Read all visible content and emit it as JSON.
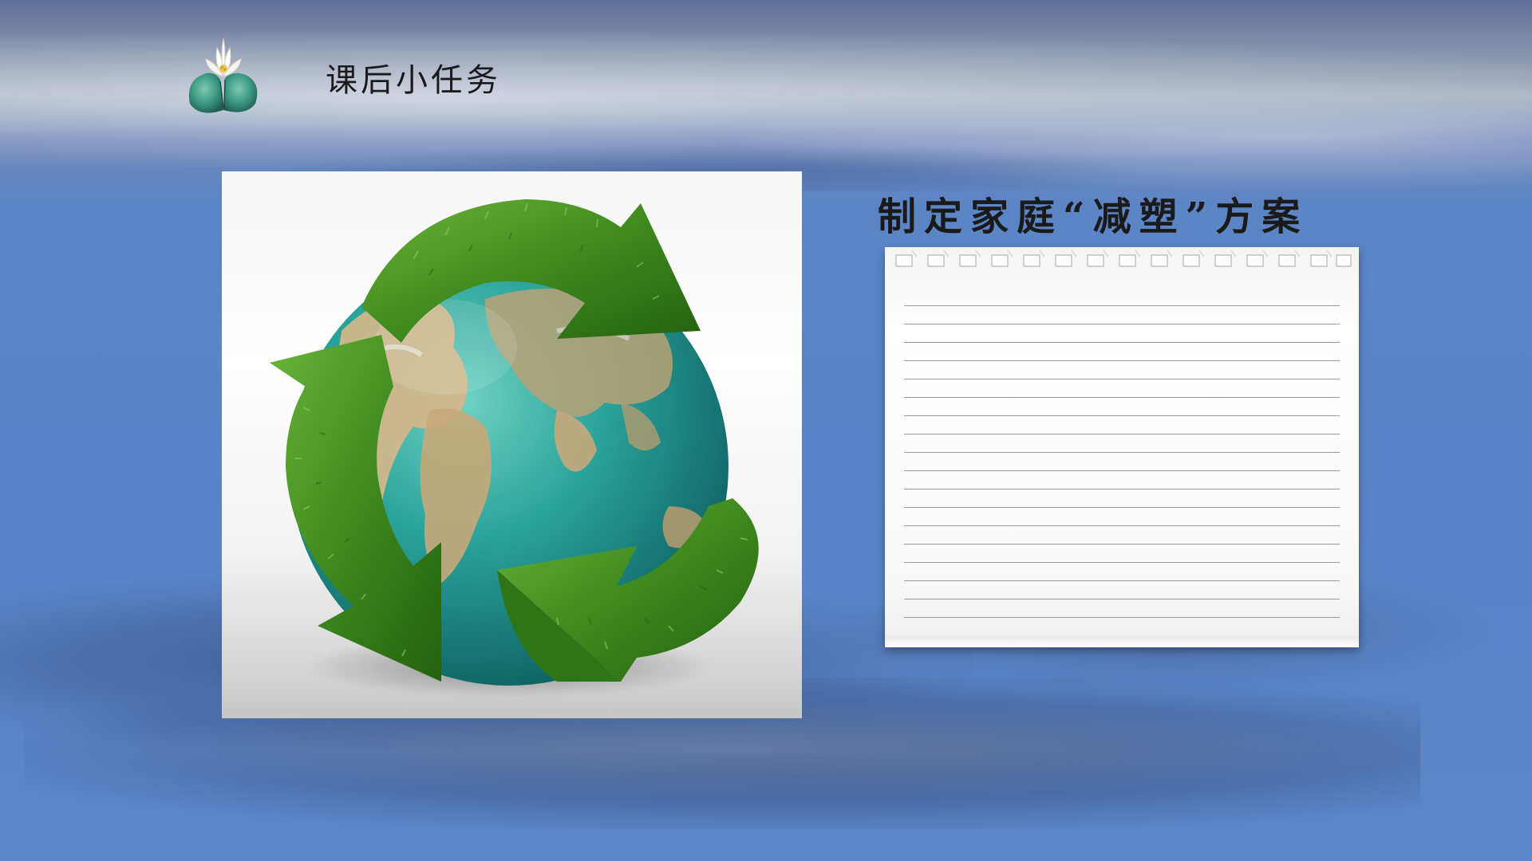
{
  "slide": {
    "title": "课后小任务",
    "plan_title": "制定家庭“减塑”方案"
  },
  "icons": {
    "header_icon": "lotus-icon",
    "image": "recycling-globe-image"
  },
  "colors": {
    "background": "#5a84c8",
    "title_text": "#1b1b1b",
    "grass": "#3f8a1e",
    "ocean": "#2aa39a"
  }
}
